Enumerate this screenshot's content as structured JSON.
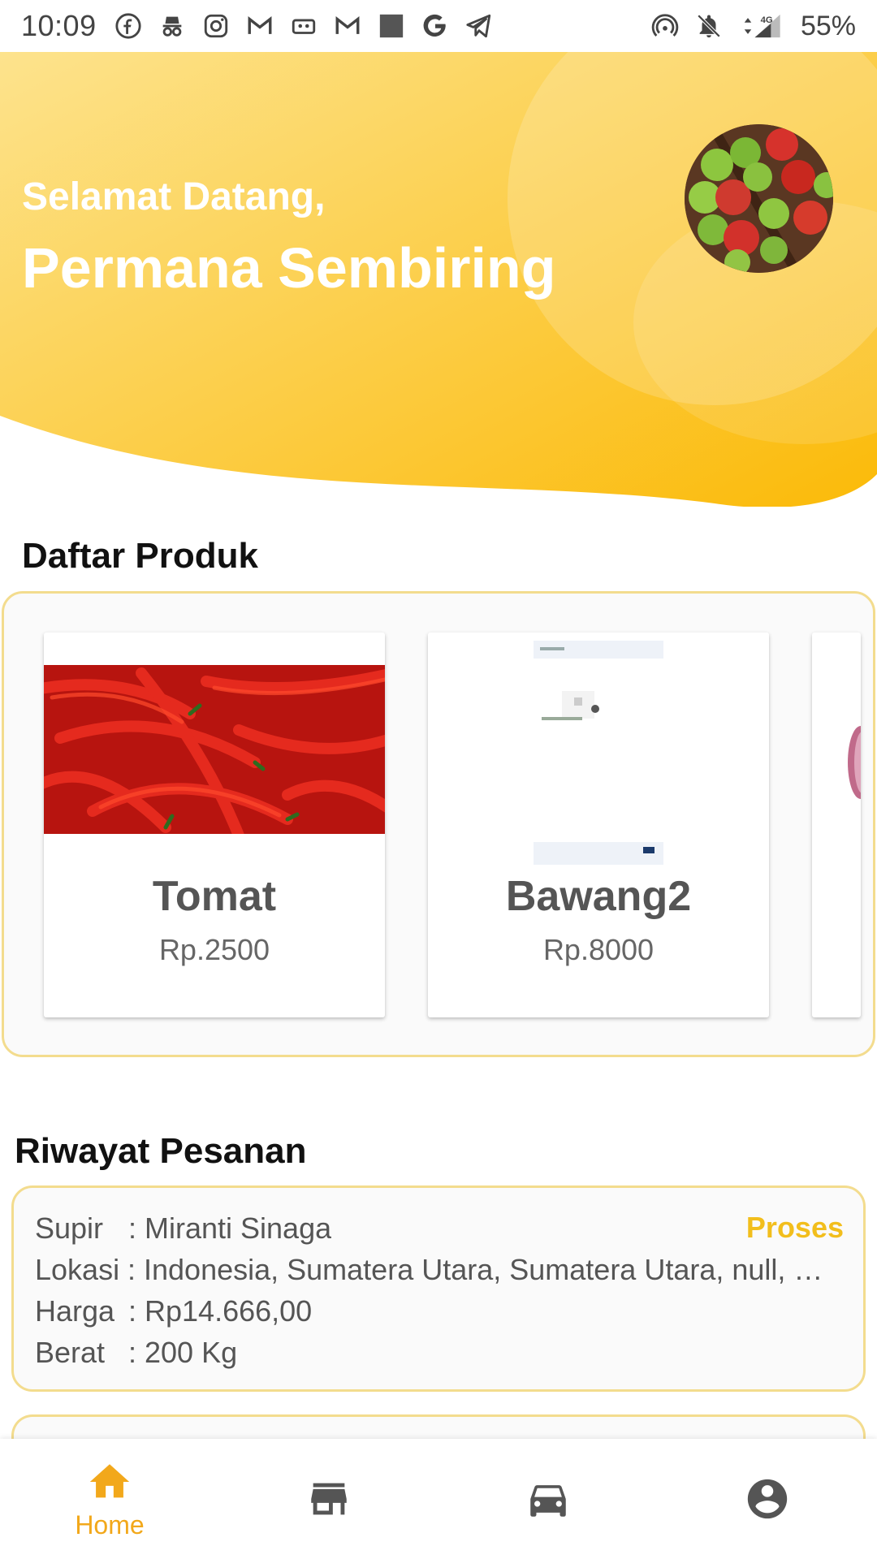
{
  "status_bar": {
    "time": "10:09",
    "battery": "55%",
    "network": "4G",
    "left_icons": [
      "facebook-icon",
      "incognito-icon",
      "instagram-icon",
      "gmail-icon",
      "cassette-icon",
      "gmail-icon",
      "square-icon",
      "google-icon",
      "telegram-icon"
    ],
    "right_icons": [
      "hotspot-icon",
      "bell-off-icon",
      "signal-icon",
      "battery-icon"
    ]
  },
  "header": {
    "greeting": "Selamat Datang,",
    "user_name": "Permana Sembiring",
    "avatar_icon": "apples-avatar"
  },
  "products": {
    "title": "Daftar Produk",
    "items": [
      {
        "name": "Tomat",
        "price": "Rp.2500",
        "image": "red-chili-image"
      },
      {
        "name": "Bawang2",
        "price": "Rp.8000",
        "image": "screenshot-image"
      },
      {
        "name": "",
        "price": "",
        "image": "onion-image"
      }
    ]
  },
  "orders": {
    "title": "Riwayat Pesanan",
    "items": [
      {
        "status": "Proses",
        "rows": [
          {
            "label": "Supir",
            "value": ": Miranti Sinaga"
          },
          {
            "label": "Lokasi",
            "value": ": Indonesia, Sumatera Utara, Sumatera Utara, null, Ke..."
          },
          {
            "label": "Harga",
            "value": ": Rp14.666,00"
          },
          {
            "label": "Berat",
            "value": ": 200 Kg"
          }
        ]
      }
    ]
  },
  "bottom_nav": {
    "items": [
      {
        "label": "Home",
        "icon": "home-icon",
        "active": true
      },
      {
        "label": "",
        "icon": "store-icon",
        "active": false
      },
      {
        "label": "",
        "icon": "car-icon",
        "active": false
      },
      {
        "label": "",
        "icon": "account-icon",
        "active": false
      }
    ]
  },
  "colors": {
    "accent": "#f2a81b",
    "header_gradient_start": "#fde28a",
    "header_gradient_end": "#fbbf10",
    "card_border": "#f3dc8e",
    "status_text": "#f2be1c"
  }
}
